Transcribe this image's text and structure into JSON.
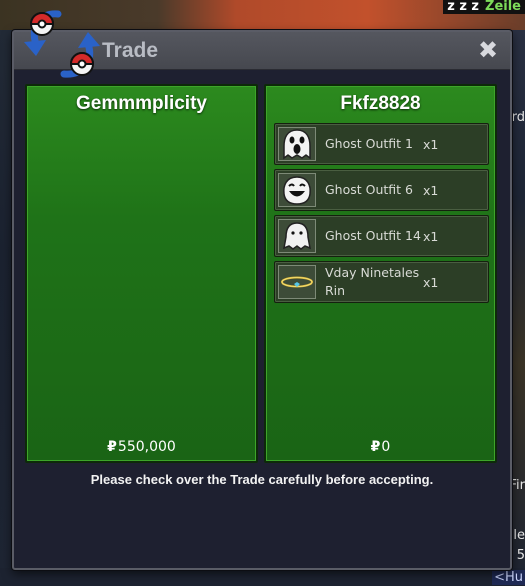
{
  "background": {
    "tag_text": "Zeile",
    "right_texts": [
      "ard",
      "Fir",
      "le",
      "5",
      "<Hu"
    ]
  },
  "window": {
    "title": "Trade",
    "close_label": "✖",
    "footer_text": "Please check over the Trade carefully before accepting."
  },
  "left_panel": {
    "player_name": "Gemmmplicity",
    "money_symbol": "₽",
    "money_amount": "550,000",
    "items": []
  },
  "right_panel": {
    "player_name": "Fkfz8828",
    "money_symbol": "₽",
    "money_amount": "0",
    "items": [
      {
        "name": "Ghost Outfit 1",
        "qty": "x1",
        "icon": "ghost-screaming-icon"
      },
      {
        "name": "Ghost Outfit 6",
        "qty": "x1",
        "icon": "ghost-laughing-icon"
      },
      {
        "name": "Ghost Outfit 14",
        "qty": "x1",
        "icon": "ghost-sheet-icon"
      },
      {
        "name": "Vday Ninetales Rin",
        "qty": "x1",
        "icon": "halo-ring-icon"
      }
    ]
  },
  "colors": {
    "panel_green": "#1f7318",
    "window_bg": "#1e2030",
    "title_bar": "#4d4f57"
  }
}
